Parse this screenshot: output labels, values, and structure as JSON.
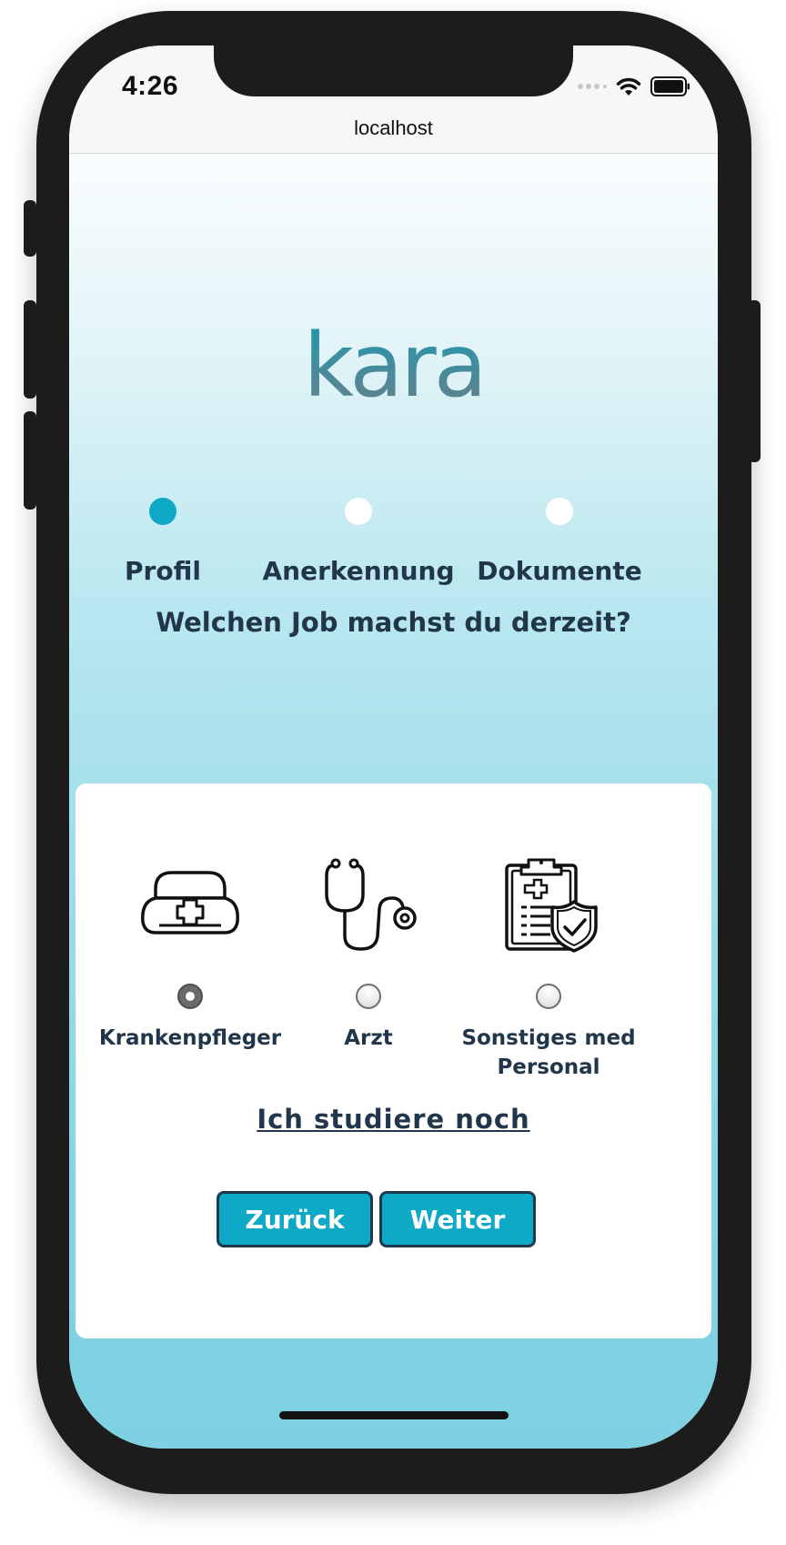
{
  "status_bar": {
    "time": "4:26",
    "url": "localhost"
  },
  "brand": {
    "logo_text": "kara"
  },
  "steps": [
    {
      "label": "Profil",
      "active": true
    },
    {
      "label": "Anerkennung",
      "active": false
    },
    {
      "label": "Dokumente",
      "active": false
    }
  ],
  "question": "Welchen Job machst du derzeit?",
  "options": [
    {
      "label": "Krankenpfleger",
      "icon": "nurse-cap-icon",
      "selected": true
    },
    {
      "label": "Arzt",
      "icon": "stethoscope-icon",
      "selected": false
    },
    {
      "label": "Sonstiges med Personal",
      "icon": "clipboard-shield-icon",
      "selected": false
    }
  ],
  "study_link": "Ich studiere noch",
  "buttons": {
    "back": "Zurück",
    "next": "Weiter"
  },
  "colors": {
    "accent": "#0ea9c7",
    "text": "#21364a",
    "dot_inactive": "#ffffff"
  }
}
